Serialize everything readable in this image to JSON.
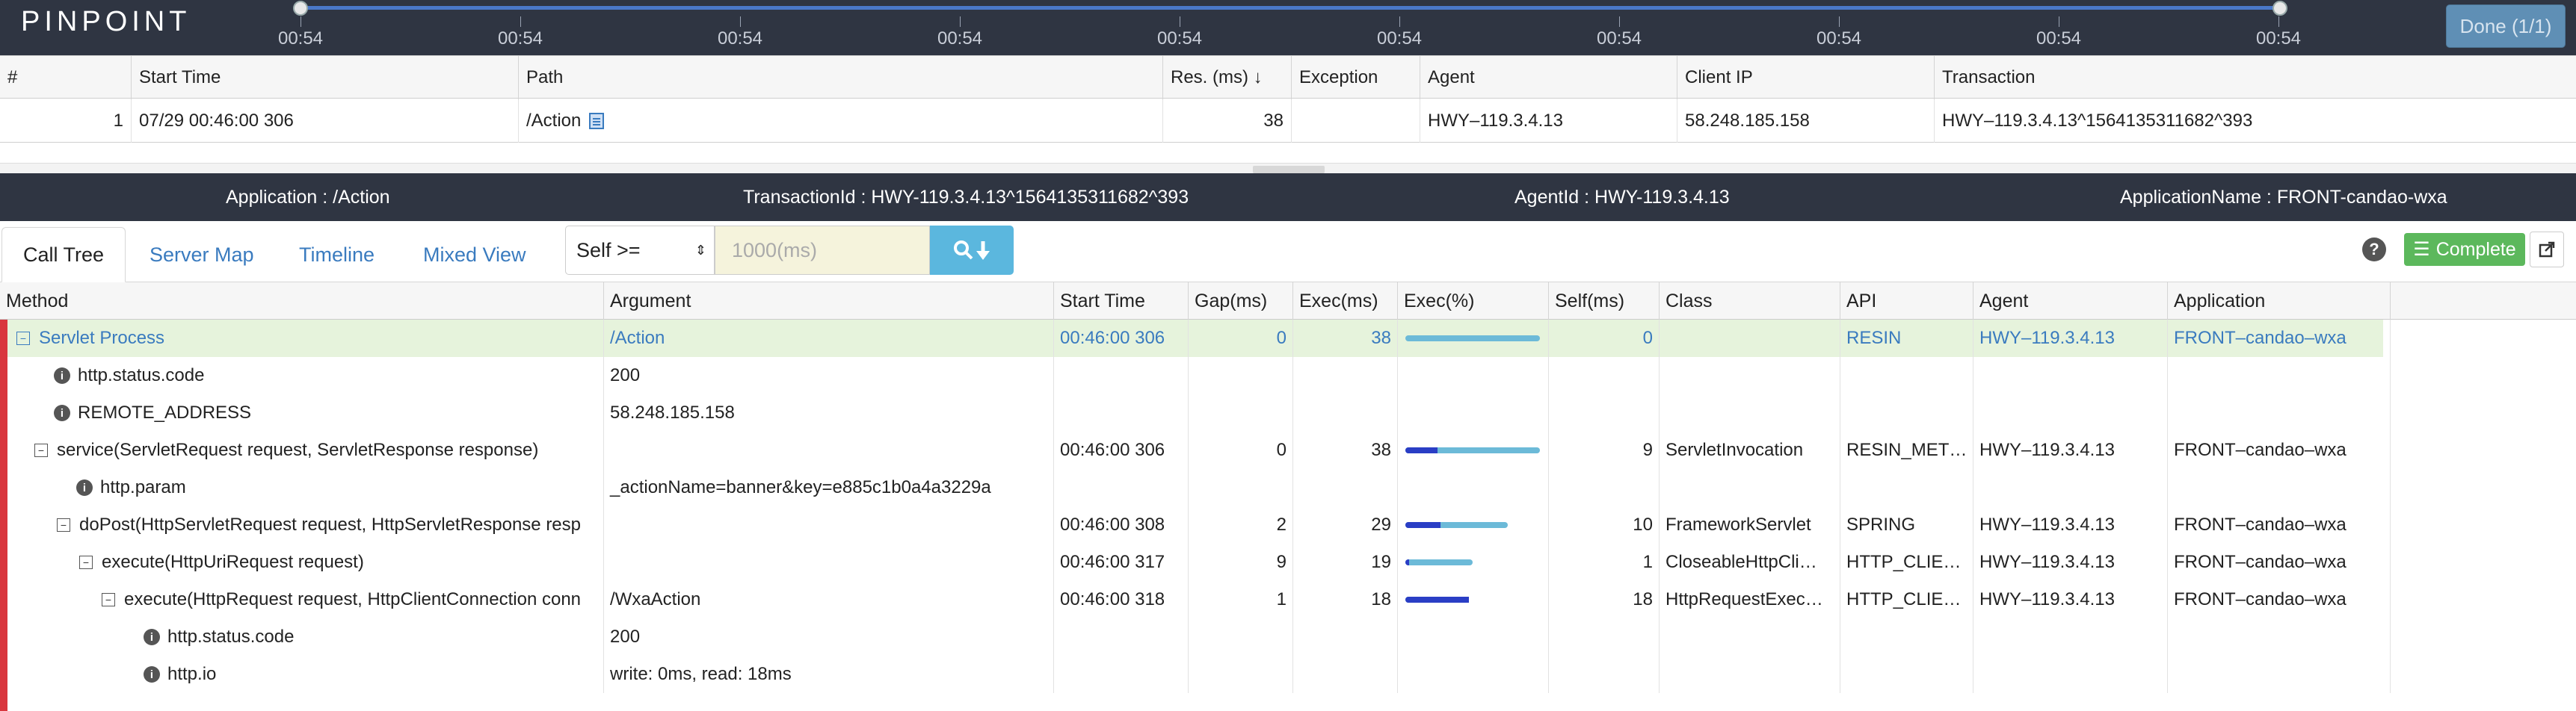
{
  "app": {
    "logo": "PINPOINT",
    "done_label": "Done (1/1)"
  },
  "timeline": {
    "ticks": [
      "00:54",
      "00:54",
      "00:54",
      "00:54",
      "00:54",
      "00:54",
      "00:54",
      "00:54",
      "00:54",
      "00:54"
    ]
  },
  "tx_table": {
    "headers": [
      "#",
      "Start Time",
      "Path",
      "Res. (ms) ↓",
      "Exception",
      "Agent",
      "Client IP",
      "Transaction"
    ],
    "row": {
      "index": "1",
      "start_time": "07/29 00:46:00 306",
      "path": "/Action",
      "res": "38",
      "exception": "",
      "agent": "HWY–119.3.4.13",
      "client_ip": "58.248.185.158",
      "transaction": "HWY–119.3.4.13^1564135311682^393"
    }
  },
  "infobar": {
    "application": "Application : /Action",
    "transaction_id": "TransactionId : HWY-119.3.4.13^1564135311682^393",
    "agent_id": "AgentId : HWY-119.3.4.13",
    "application_name": "ApplicationName : FRONT-candao-wxa"
  },
  "tabs": {
    "call_tree": "Call Tree",
    "server_map": "Server Map",
    "timeline": "Timeline",
    "mixed_view": "Mixed View"
  },
  "filter": {
    "select_value": "Self >=",
    "input_placeholder": "1000(ms)"
  },
  "toolbar": {
    "help": "?",
    "complete_label": "Complete"
  },
  "colors": {
    "header_dark": "#2f3542",
    "accent_blue": "#3a7bbf",
    "exec_bar": "#6cbad8",
    "self_bar": "#2a3ec5",
    "highlight_row": "#e6f3dc",
    "error_bar": "#d9363e",
    "complete_green": "#5cb85c"
  },
  "call_tree": {
    "headers": [
      "Method",
      "Argument",
      "Start Time",
      "Gap(ms)",
      "Exec(ms)",
      "Exec(%)",
      "Self(ms)",
      "Class",
      "API",
      "Agent",
      "Application"
    ],
    "rows": [
      {
        "method": "Servlet Process",
        "argument": "/Action",
        "start": "00:46:00 306",
        "gap": "0",
        "exec": "38",
        "exec_pct": 1.0,
        "self_pct": 0.0,
        "self": "0",
        "class": "",
        "api": "RESIN",
        "agent": "HWY–119.3.4.13",
        "application": "FRONT–candao–wxa"
      },
      {
        "method": "http.status.code",
        "argument": "200",
        "start": "",
        "gap": "",
        "exec": "",
        "exec_pct": 0,
        "self_pct": 0,
        "self": "",
        "class": "",
        "api": "",
        "agent": "",
        "application": ""
      },
      {
        "method": "REMOTE_ADDRESS",
        "argument": "58.248.185.158",
        "start": "",
        "gap": "",
        "exec": "",
        "exec_pct": 0,
        "self_pct": 0,
        "self": "",
        "class": "",
        "api": "",
        "agent": "",
        "application": ""
      },
      {
        "method": "service(ServletRequest request, ServletResponse response)",
        "argument": "",
        "start": "00:46:00 306",
        "gap": "0",
        "exec": "38",
        "exec_pct": 1.0,
        "self_pct": 0.24,
        "self": "9",
        "class": "ServletInvocation",
        "api": "RESIN_MET…",
        "agent": "HWY–119.3.4.13",
        "application": "FRONT–candao–wxa"
      },
      {
        "method": "http.param",
        "argument": "_actionName=banner&key=e885c1b0a4a3229a",
        "start": "",
        "gap": "",
        "exec": "",
        "exec_pct": 0,
        "self_pct": 0,
        "self": "",
        "class": "",
        "api": "",
        "agent": "",
        "application": ""
      },
      {
        "method": "doPost(HttpServletRequest request, HttpServletResponse resp",
        "argument": "",
        "start": "00:46:00 308",
        "gap": "2",
        "exec": "29",
        "exec_pct": 0.76,
        "self_pct": 0.26,
        "self": "10",
        "class": "FrameworkServlet",
        "api": "SPRING",
        "agent": "HWY–119.3.4.13",
        "application": "FRONT–candao–wxa"
      },
      {
        "method": "execute(HttpUriRequest request)",
        "argument": "",
        "start": "00:46:00 317",
        "gap": "9",
        "exec": "19",
        "exec_pct": 0.5,
        "self_pct": 0.03,
        "self": "1",
        "class": "CloseableHttpCli…",
        "api": "HTTP_CLIE…",
        "agent": "HWY–119.3.4.13",
        "application": "FRONT–candao–wxa"
      },
      {
        "method": "execute(HttpRequest request, HttpClientConnection conn",
        "argument": "/WxaAction",
        "start": "00:46:00 318",
        "gap": "1",
        "exec": "18",
        "exec_pct": 0.47,
        "self_pct": 0.47,
        "self": "18",
        "class": "HttpRequestExec…",
        "api": "HTTP_CLIE…",
        "agent": "HWY–119.3.4.13",
        "application": "FRONT–candao–wxa"
      },
      {
        "method": "http.status.code",
        "argument": "200",
        "start": "",
        "gap": "",
        "exec": "",
        "exec_pct": 0,
        "self_pct": 0,
        "self": "",
        "class": "",
        "api": "",
        "agent": "",
        "application": ""
      },
      {
        "method": "http.io",
        "argument": "write: 0ms, read: 18ms",
        "start": "",
        "gap": "",
        "exec": "",
        "exec_pct": 0,
        "self_pct": 0,
        "self": "",
        "class": "",
        "api": "",
        "agent": "",
        "application": ""
      }
    ]
  }
}
